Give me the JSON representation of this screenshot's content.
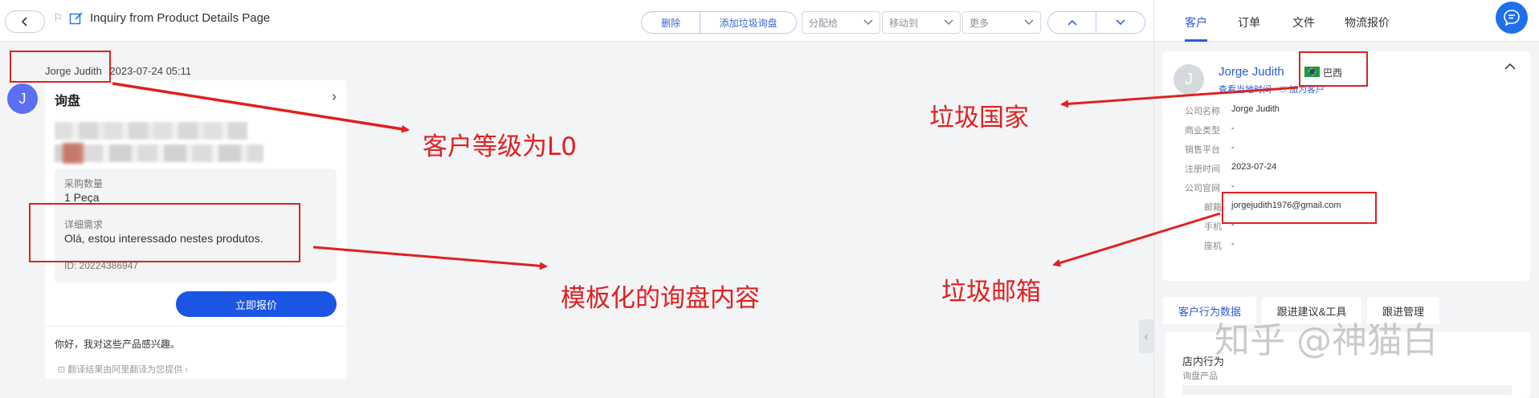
{
  "toolbar": {
    "title": "Inquiry from Product Details Page",
    "delete_label": "删除",
    "add_spam_label": "添加垃圾询盘",
    "assign_label": "分配给",
    "move_label": "移动到",
    "more_label": "更多"
  },
  "message": {
    "sender": "Jorge Judith",
    "time": "2023-07-24 05:11",
    "avatar_letter": "J",
    "card_title": "询盘",
    "qty_label": "采购数量",
    "qty_value": "1 Peça",
    "req_label": "详细需求",
    "req_value": "Olá, estou interessado nestes produtos.",
    "id_text": "ID:  20224386947",
    "quote_button": "立即报价",
    "translated_text": "你好，我对这些产品感兴趣。",
    "translate_note": "翻译结果由阿里翻译为您提供"
  },
  "annotations": {
    "level": "客户等级为L0",
    "template": "模板化的询盘内容",
    "spam_country": "垃圾国家",
    "spam_email": "垃圾邮箱",
    "color": "#e02020"
  },
  "right_tabs": [
    "客户",
    "订单",
    "文件",
    "物流报价"
  ],
  "customer": {
    "avatar_letter": "J",
    "name": "Jorge Judith",
    "country": "巴西",
    "local_time_link": "查看当地时间",
    "add_customer_link": "加为客户",
    "fields": [
      {
        "label": "公司名称",
        "value": "Jorge Judith"
      },
      {
        "label": "商业类型",
        "value": "-"
      },
      {
        "label": "销售平台",
        "value": "-"
      },
      {
        "label": "注册时间",
        "value": "2023-07-24"
      },
      {
        "label": "公司官网",
        "value": "-"
      },
      {
        "label": "邮箱",
        "value": "jorgejudith1976@gmail.com"
      },
      {
        "label": "手机",
        "value": "-"
      },
      {
        "label": "座机",
        "value": "-"
      }
    ]
  },
  "bottom_tabs": [
    "客户行为数据",
    "跟进建议&工具",
    "跟进管理"
  ],
  "behavior": {
    "title": "店内行为",
    "subtitle": "询盘产品"
  },
  "watermark": "知乎 @神猫白",
  "colors": {
    "accent": "#2a5bd7",
    "primary_button": "#1a55e3",
    "avatar": "#5a70f0"
  }
}
